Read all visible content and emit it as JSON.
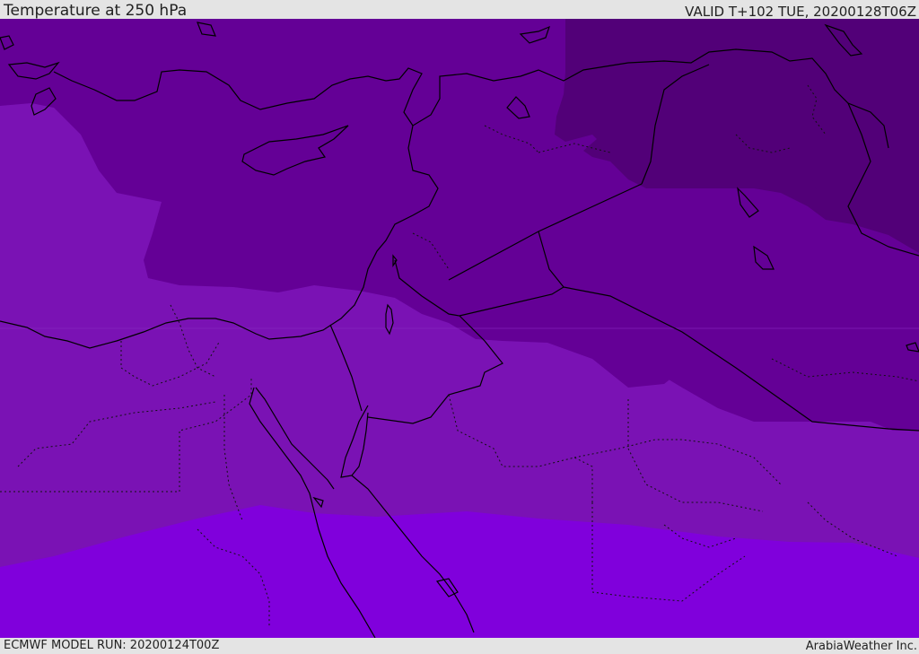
{
  "header": {
    "title": "Temperature at 250 hPa",
    "valid": "VALID T+102 TUE, 20200128T06Z"
  },
  "footer": {
    "model_run": "ECMWF MODEL RUN: 20200124T00Z",
    "credit": "ArabiaWeather Inc."
  },
  "colors": {
    "band_coldest": "#520078",
    "band_cold": "#640096",
    "band_mid": "#7a12b4",
    "band_warm": "#8000dc",
    "coastline": "#000000",
    "background_bar": "#e4e4e4"
  }
}
